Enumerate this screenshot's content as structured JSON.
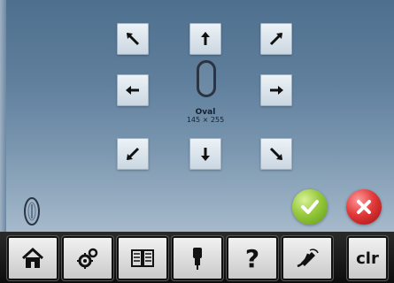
{
  "hoop": {
    "name": "Oval",
    "size": "145 × 255"
  },
  "toolbar": {
    "home_icon": "home-icon",
    "settings_icon": "settings-gears-icon",
    "manual_icon": "tutorial-book-icon",
    "needle_icon": "needle-info-icon",
    "help_label": "?",
    "eco_icon": "eco-mode-icon",
    "clear_label": "clr"
  },
  "actions": {
    "confirm_icon": "checkmark-icon",
    "cancel_icon": "close-icon"
  },
  "colors": {
    "screen_top": "#4f6f8e",
    "screen_bottom": "#a6bacb",
    "confirm": "#7cb82f",
    "cancel": "#d92f2f"
  }
}
